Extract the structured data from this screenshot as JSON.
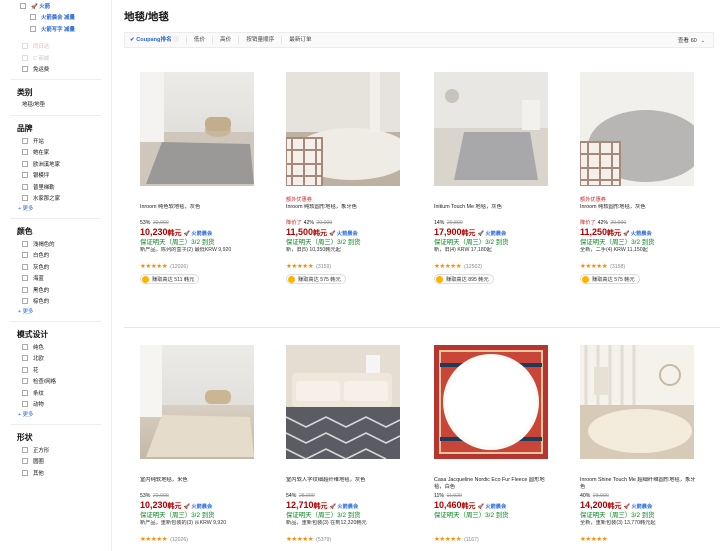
{
  "sidebar": {
    "delivery_top": "🚀 火箭",
    "delivery_subs": [
      "火箭晨会 减量",
      "火箭写字 减量"
    ],
    "faded_items": [
      "同日达",
      "C 商城"
    ],
    "free_shipping": "免运费",
    "category_title": "类别",
    "category_current": "地毯/地垫",
    "brand_title": "品牌",
    "brands": [
      "开站",
      "她在家",
      "欧洲溪地家",
      "银模坪",
      "普里梯勒",
      "水家那之家"
    ],
    "brand_more": "+ 更多",
    "color_title": "颜色",
    "colors": [
      "浅褐色的",
      "白色的",
      "灰色的",
      "海蓝",
      "黑色的",
      "棕色的"
    ],
    "color_more": "+ 更多",
    "pattern_title": "模式设计",
    "patterns": [
      "纯色",
      "北欧",
      "花",
      "检查/网格",
      "条纹",
      "动物"
    ],
    "pattern_more": "+ 更多",
    "shape_title": "形状",
    "shapes": [
      "正方形",
      "圆圈",
      "其他"
    ]
  },
  "main": {
    "title": "地毯/地毯",
    "sort": {
      "first": "✔ Coupang排名",
      "info_icon": "ⓘ",
      "options": [
        "低价",
        "高价",
        "按销量顺序",
        "最新订单"
      ],
      "view_label": "查看 60",
      "view_caret": "⌄"
    }
  },
  "products": [
    {
      "badge": "",
      "name": "Inroom 纯色软地毯，灰色",
      "low_tag": "",
      "pct": "53%",
      "orig": "22,000",
      "price": "10,230",
      "unit": "韩元",
      "rocket": "🚀 火箭晨会",
      "delivery": "保证明天（周三）3/2 到货",
      "option": "新产品，陈列的盒子(2) 最低KRW 9,920",
      "stars": "★★★★★",
      "reviews": "(12026)",
      "cashback": "赚取高达 511 韩元"
    },
    {
      "badge": "额外优惠券",
      "name": "Inroom 纯软圆形地毯，象牙色",
      "low_tag": "降价了",
      "pct": "42%",
      "orig": "20,000",
      "price": "11,500",
      "unit": "韩元",
      "rocket": "🚀 火箭晨会",
      "delivery": "保证明天（周三）3/2 到货",
      "option": "新，旧(5) 10,350韩元起",
      "stars": "★★★★★",
      "reviews": "(3159)",
      "cashback": "赚取高达 575 韩元"
    },
    {
      "badge": "",
      "name": "Initium Touch Me 地毯，灰色",
      "low_tag": "",
      "pct": "14%",
      "orig": "20,800",
      "price": "17,900",
      "unit": "韩元",
      "rocket": "🚀 火箭晨会",
      "delivery": "保证明天（周三）3/2 到货",
      "option": "新，旧(4) KRW 17,180起",
      "stars": "★★★★★",
      "reviews": "(12502)",
      "cashback": "赚取高达 895 韩元"
    },
    {
      "badge": "额外优惠券",
      "name": "Inroom 纯软圆形地毯，灰色",
      "low_tag": "降价了",
      "pct": "42%",
      "orig": "20,000",
      "price": "11,250",
      "unit": "韩元",
      "rocket": "🚀 火箭晨会",
      "delivery": "保证明天（周三）3/2 到货",
      "option": "全新，二手(4) KRW 11,150起",
      "stars": "★★★★★",
      "reviews": "(3158)",
      "cashback": "赚取高达 575 韩元"
    },
    {
      "badge": "",
      "name": "室内纯软地毯，米色",
      "low_tag": "",
      "pct": "53%",
      "orig": "22,000",
      "price": "10,230",
      "unit": "韩元",
      "rocket": "🚀 火箭晨会",
      "delivery": "保证明天（周三）3/2 到货",
      "option": "新产品，重新包装的(3) 从KRW 9,920",
      "stars": "★★★★★",
      "reviews": "(12026)",
      "cashback": ""
    },
    {
      "badge": "",
      "name": "室内软人字纹细超纤维地毯，灰色",
      "low_tag": "",
      "pct": "54%",
      "orig": "28,000",
      "price": "12,710",
      "unit": "韩元",
      "rocket": "🚀 火箭晨会",
      "delivery": "保证明天（周三）3/2 到货",
      "option": "新品，重新包装(3) 在到12,320韩元",
      "stars": "★★★★★",
      "reviews": "(5379)",
      "cashback": ""
    },
    {
      "badge": "",
      "name": "Casa Jacqueline Nordic Eco Fur Fleece 圆形地毯，白色",
      "low_tag": "",
      "pct": "11%",
      "orig": "11,920",
      "price": "10,460",
      "unit": "韩元",
      "rocket": "🚀 火箭晨会",
      "delivery": "保证明天（周三）3/2 到货",
      "option": "",
      "stars": "★★★★★",
      "reviews": "(1167)",
      "cashback": ""
    },
    {
      "badge": "",
      "name": "Inroom Shine Touch Me 超细纤维圆形地毯，象牙色",
      "low_tag": "",
      "pct": "40%",
      "orig": "23,900",
      "price": "14,200",
      "unit": "韩元",
      "rocket": "🚀 火箭晨会",
      "delivery": "保证明天（周三）3/2 到货",
      "option": "全新，重新包装(3) 13,770韩元起",
      "stars": "★★★★★",
      "reviews": "",
      "cashback": ""
    }
  ]
}
